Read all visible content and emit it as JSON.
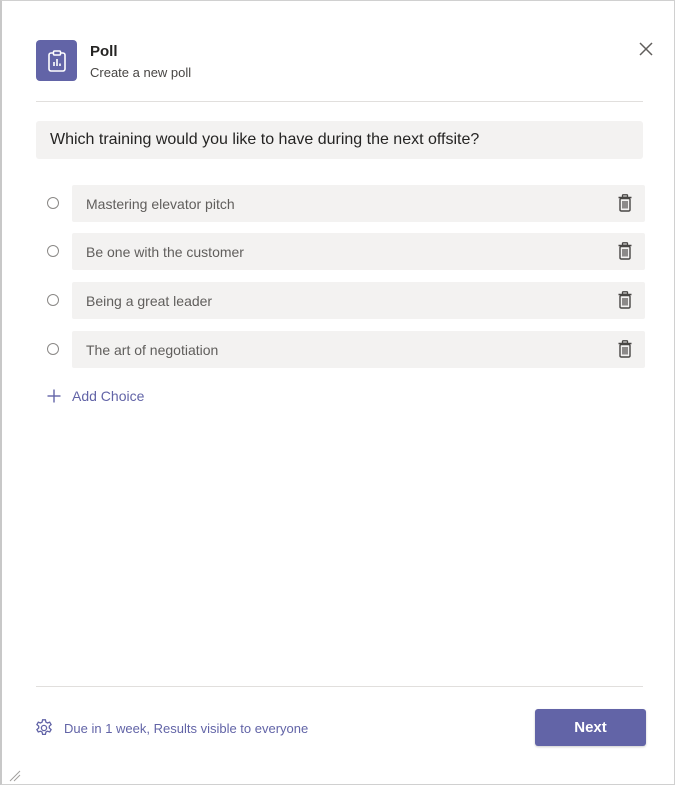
{
  "header": {
    "title": "Poll",
    "subtitle": "Create a new poll",
    "app_icon": "poll-clipboard-icon",
    "close_icon": "close-icon"
  },
  "question": {
    "value": "Which training would you like to have during the next offsite?"
  },
  "choices": [
    {
      "label": "Mastering elevator pitch"
    },
    {
      "label": "Be one with the customer"
    },
    {
      "label": "Being a great leader"
    },
    {
      "label": "The art of negotiation"
    }
  ],
  "add_choice": {
    "label": "Add Choice",
    "icon": "plus-icon"
  },
  "footer": {
    "settings_text": "Due in 1 week, Results visible to everyone",
    "settings_icon": "gear-icon",
    "next_label": "Next"
  },
  "colors": {
    "accent": "#6264a7",
    "field_background": "#f3f2f1",
    "divider": "#e1dfdd"
  }
}
